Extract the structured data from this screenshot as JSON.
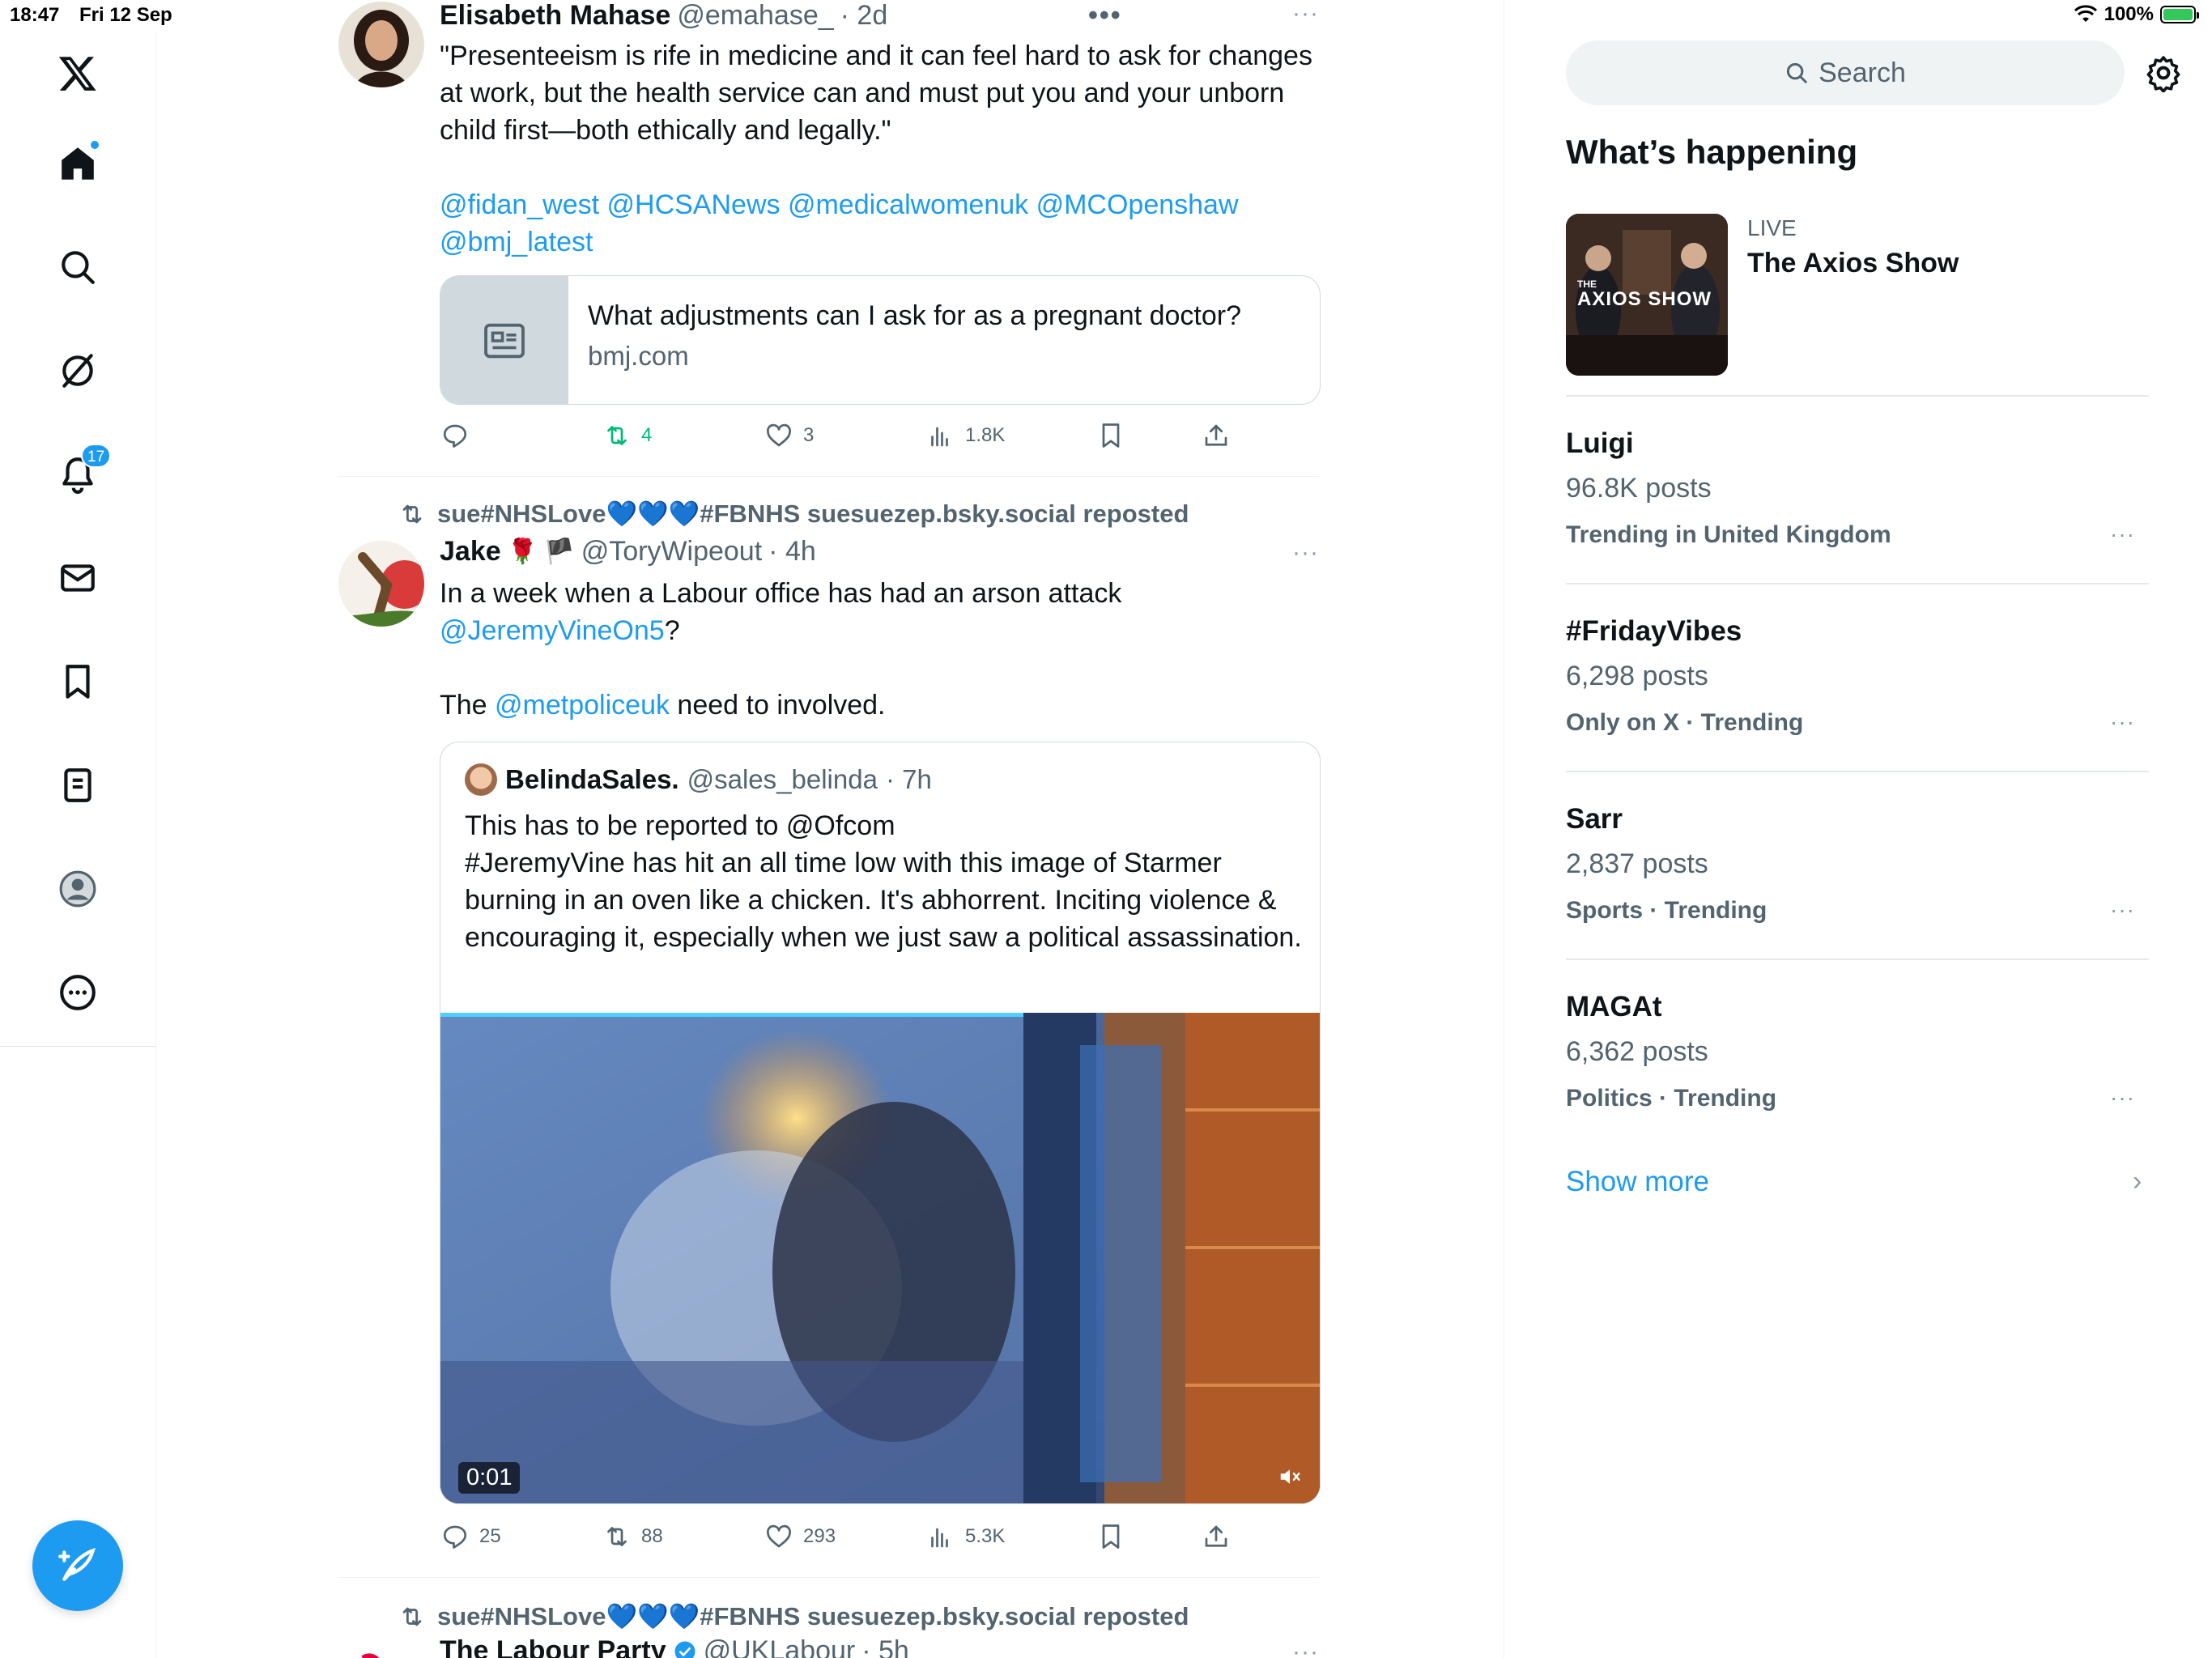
{
  "status": {
    "time": "18:47",
    "date": "Fri 12 Sep",
    "battery": "100%"
  },
  "nav": {
    "notifications_count": "17"
  },
  "tweets": [
    {
      "author": "Elisabeth Mahase",
      "handle": "@emahase_",
      "time": "· 2d",
      "text": "\"Presenteeism is rife in medicine and it can feel hard to ask for changes at work, but the health service can and must put you and your unborn child first—both ethically and legally.\"",
      "mentions_line1": "@fidan_west @HCSANews @medicalwomenuk @MCOpenshaw",
      "mentions_line2": "@bmj_latest",
      "link_card": {
        "title": "What adjustments can I ask for as a pregnant doctor?",
        "domain": "bmj.com"
      },
      "stats": {
        "replies": "",
        "reposts": "4",
        "likes": "3",
        "views": "1.8K"
      }
    },
    {
      "reposted_by": "sue#NHSLove💙💙💙#FBNHS suesuezep.bsky.social reposted",
      "author": "Jake",
      "flags": "🌹 🏴",
      "handle": "@ToryWipeout",
      "time": "· 4h",
      "text_line1": "In a week when a Labour office has had an arson attack",
      "text_mention": "@JeremyVineOn5",
      "text_q": "?",
      "text_the": "The ",
      "text_police": "@metpoliceuk",
      "text_end": " need to involved.",
      "quote": {
        "author": "BelindaSales.",
        "handle": "@sales_belinda",
        "time": "· 7h",
        "text": "This has to be reported to @Ofcom\n#JeremyVine has hit an all time low with this image of Starmer burning in an oven like a chicken. It's abhorrent. Inciting violence & encouraging it, especially when we just saw a political assassination.",
        "video_time": "0:01"
      },
      "stats": {
        "replies": "25",
        "reposts": "88",
        "likes": "293",
        "views": "5.3K"
      }
    },
    {
      "reposted_by": "sue#NHSLove💙💙💙#FBNHS suesuezep.bsky.social reposted",
      "author": "The Labour Party",
      "handle": "@UKLabour",
      "time": "· 5h"
    }
  ],
  "sidebar": {
    "search_placeholder": "Search",
    "section_title": "What’s happening",
    "live": {
      "label": "LIVE",
      "title": "The Axios Show",
      "thumb_text": "AXIOS SHOW",
      "thumb_small": "THE"
    },
    "trends": [
      {
        "name": "Luigi",
        "posts": "96.8K posts",
        "context": "Trending in United Kingdom"
      },
      {
        "name": "#FridayVibes",
        "posts": "6,298 posts",
        "context": "Only on X · Trending"
      },
      {
        "name": "Sarr",
        "posts": "2,837 posts",
        "context": "Sports · Trending"
      },
      {
        "name": "MAGAt",
        "posts": "6,362 posts",
        "context": "Politics · Trending"
      }
    ],
    "show_more": "Show more"
  },
  "colors": {
    "accent": "#1d9bf0",
    "repost_green": "#00ba7c",
    "secondary_text": "#536471"
  }
}
